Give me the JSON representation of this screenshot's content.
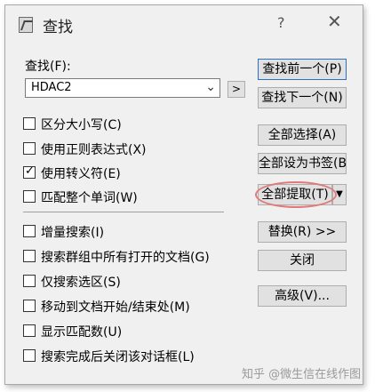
{
  "window": {
    "title": "查找",
    "help": "?",
    "close": "✕"
  },
  "find": {
    "label": "查找(F):",
    "value": "HDAC2",
    "more_button": ">"
  },
  "options": [
    {
      "label": "区分大小写(C)",
      "checked": false
    },
    {
      "label": "使用正则表达式(X)",
      "checked": false
    },
    {
      "label": "使用转义符(E)",
      "checked": true
    },
    {
      "label": "匹配整个单词(W)",
      "checked": false
    },
    {
      "label": "增量搜索(I)",
      "checked": false
    },
    {
      "label": "搜索群组中所有打开的文档(G)",
      "checked": false
    },
    {
      "label": "仅搜索选区(S)",
      "checked": false
    },
    {
      "label": "移动到文档开始/结束处(M)",
      "checked": false
    },
    {
      "label": "显示匹配数(U)",
      "checked": false
    },
    {
      "label": "搜索完成后关闭该对话框(L)",
      "checked": false
    }
  ],
  "buttons": {
    "find_prev": "查找前一个(P)",
    "find_next": "查找下一个(N)",
    "select_all": "全部选择(A)",
    "bookmark_all": "全部设为书签(B)",
    "extract_all": "全部提取(T)",
    "replace": "替换(R) >>",
    "close": "关闭",
    "advanced": "高级(V)..."
  },
  "watermark": "知乎 @微生信在线作图",
  "colors": {
    "dialog_bg": "#f0f0f0",
    "highlight": "#e07a7a",
    "default_border": "#2f6fbf"
  }
}
